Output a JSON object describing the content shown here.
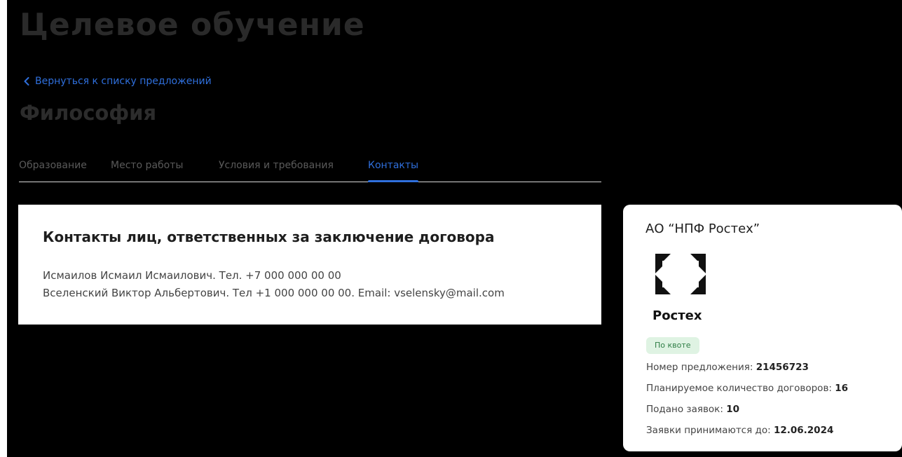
{
  "page": {
    "title": "Целевое обучение",
    "back_link": "Вернуться к списку предложений",
    "subject": "Философия"
  },
  "tabs": [
    {
      "label": "Образование",
      "active": false
    },
    {
      "label": "Место работы",
      "active": false
    },
    {
      "label": "Условия и требования",
      "active": false
    },
    {
      "label": "Контакты",
      "active": true
    }
  ],
  "contacts": {
    "heading": "Контакты лиц, ответственных за заключение договора",
    "lines": [
      "Исмаилов Исмаил Исмаилович. Тел. +7 000 000 00 00",
      "Вселенский Виктор Альбертович. Тел +1 000 000 00 00. Email: vselensky@mail.com"
    ]
  },
  "organization": {
    "name": "АО “НПФ Ростех”",
    "logo_text": "Ростех",
    "badge": "По квоте",
    "details": [
      {
        "label": "Номер предложения:",
        "value": "21456723"
      },
      {
        "label": "Планируемое количество договоров:",
        "value": "16"
      },
      {
        "label": "Подано заявок:",
        "value": "10"
      },
      {
        "label": "Заявки принимаются до:",
        "value": "12.06.2024"
      }
    ]
  },
  "colors": {
    "accent": "#2f6fdc",
    "badge_bg": "#dff3e3",
    "badge_text": "#2e7d45",
    "background": "#000000"
  },
  "icons": [
    "chevron-left-icon",
    "rostec-logo-icon"
  ]
}
